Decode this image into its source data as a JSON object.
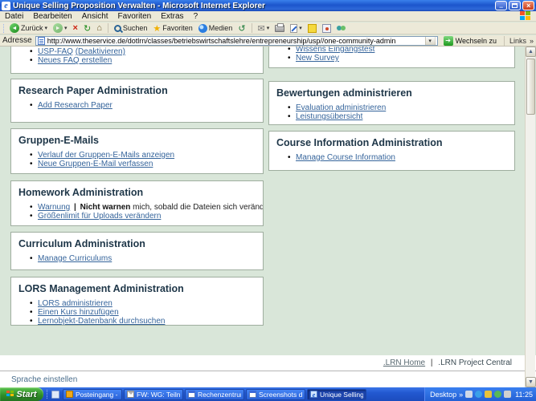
{
  "window": {
    "title": "Unique Selling Proposition Verwalten - Microsoft Internet Explorer"
  },
  "menu_bar": {
    "items": [
      "Datei",
      "Bearbeiten",
      "Ansicht",
      "Favoriten",
      "Extras",
      "?"
    ]
  },
  "toolbar": {
    "back": "Zurück",
    "search": "Suchen",
    "favorites": "Favoriten",
    "media": "Medien"
  },
  "address_bar": {
    "label": "Adresse",
    "url": "http://www.theservice.de/dotlrn/classes/betriebswirtschaftslehre/entrepreneurship/usp//one-community-admin",
    "go": "Wechseln zu",
    "links": "Links"
  },
  "page": {
    "faq_panel": {
      "link1": "USP-FAQ",
      "link1b": "(Deaktivieren)",
      "link2": "Neues FAQ erstellen"
    },
    "survey_panel": {
      "link1": "Wissens Eingangstest",
      "link2": "New Survey"
    },
    "research_panel": {
      "title": "Research Paper Administration",
      "link1": "Add Research Paper"
    },
    "bewertungen_panel": {
      "title": "Bewertungen administrieren",
      "link1": "Evaluation administrieren",
      "link2": "Leistungsübersicht"
    },
    "gruppen_panel": {
      "title": "Gruppen-E-Mails",
      "link1": "Verlauf der Gruppen-E-Mails anzeigen",
      "link2": "Neue Gruppen-E-Mail verfassen"
    },
    "course_panel": {
      "title": "Course Information Administration",
      "link1": "Manage Course Information"
    },
    "homework_panel": {
      "title": "Homework Administration",
      "warn_link": "Warnung",
      "warn_sep": "|",
      "warn_bold": "Nicht warnen",
      "warn_text": "mich, sobald die Dateien sich verändert haben.",
      "link2": "Größenlimit für Uploads verändern"
    },
    "curriculum_panel": {
      "title": "Curriculum Administration",
      "link1": "Manage Curriculums"
    },
    "lors_panel": {
      "title": "LORS Management Administration",
      "link1": "LORS administrieren",
      "link2": "Einen Kurs hinzufügen",
      "link3": "Lernobjekt-Datenbank durchsuchen"
    },
    "footer": {
      "home_link": ".LRN Home",
      "separator": "|",
      "central_link": ".LRN Project Central",
      "language_link": "Sprache einstellen"
    }
  },
  "taskbar": {
    "start": "Start",
    "tasks": [
      {
        "label": "Posteingang - Micros..."
      },
      {
        "label": "FW: WG: Teilnahme v..."
      },
      {
        "label": "Rechenzentrum Uni K..."
      },
      {
        "label": "Screenshots dotLRN..."
      },
      {
        "label": "Unique Selling Proposi..."
      }
    ],
    "tray": {
      "desktop": "Desktop",
      "time": "11:25"
    }
  },
  "colors": {
    "titlebar_blue": "#1c55cc",
    "page_background": "#d9e6d9",
    "panel_border": "#9fae9f",
    "heading": "#1e3648",
    "link": "#35649b",
    "taskbar_blue": "#2258d0",
    "start_green": "#2f8c28"
  }
}
